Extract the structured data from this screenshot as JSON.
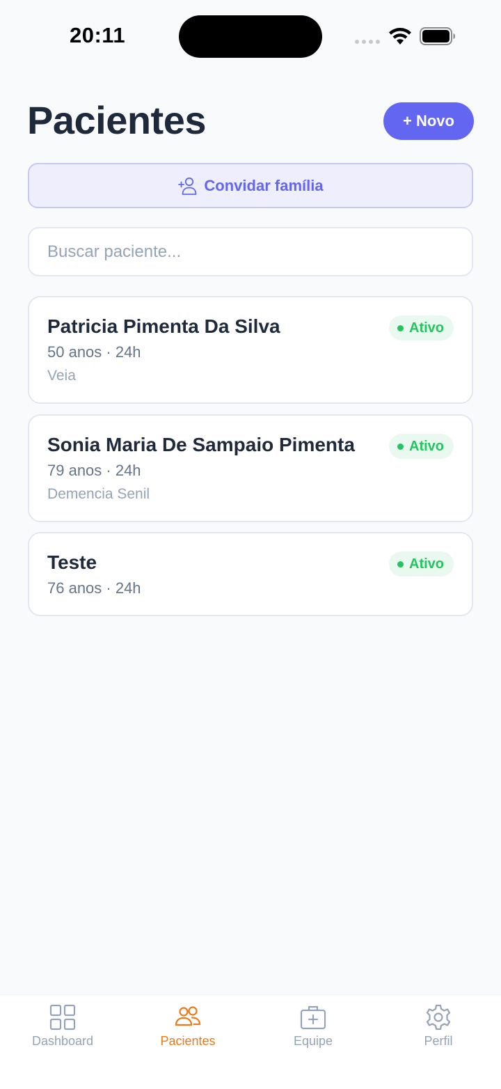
{
  "status_bar": {
    "time": "20:11"
  },
  "header": {
    "title": "Pacientes",
    "new_button_label": "+ Novo"
  },
  "invite": {
    "label": "Convidar família",
    "icon": "user-plus-icon"
  },
  "search": {
    "placeholder": "Buscar paciente...",
    "value": ""
  },
  "patients": [
    {
      "name": "Patricia Pimenta Da Silva",
      "meta": "50 anos · 24h",
      "diagnosis": "Veia",
      "status": "Ativo"
    },
    {
      "name": "Sonia Maria De Sampaio Pimenta",
      "meta": "79 anos · 24h",
      "diagnosis": "Demencia Senil",
      "status": "Ativo"
    },
    {
      "name": "Teste",
      "meta": "76 anos · 24h",
      "diagnosis": "",
      "status": "Ativo"
    }
  ],
  "tabs": [
    {
      "label": "Dashboard",
      "icon": "grid-icon",
      "active": false
    },
    {
      "label": "Pacientes",
      "icon": "users-icon",
      "active": true
    },
    {
      "label": "Equipe",
      "icon": "medical-kit-icon",
      "active": false
    },
    {
      "label": "Perfil",
      "icon": "gear-icon",
      "active": false
    }
  ],
  "colors": {
    "accent": "#6366f1",
    "active_tab": "#ea7a1a",
    "status_active": "#22c55e",
    "inactive_tab": "#94a3b8"
  }
}
